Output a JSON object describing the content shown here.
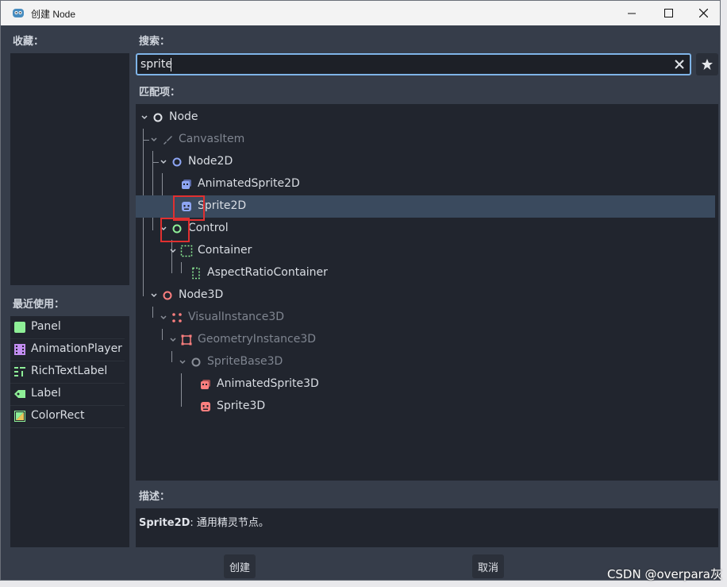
{
  "window": {
    "title": "创建 Node"
  },
  "labels": {
    "favorites": "收藏：",
    "recent": "最近使用：",
    "search": "搜索：",
    "matches": "匹配项：",
    "description": "描述："
  },
  "search": {
    "value": "sprite",
    "placeholder": ""
  },
  "tree": [
    {
      "label": "Node",
      "icon": "node-icon",
      "depth": 0,
      "dim": false,
      "selected": false
    },
    {
      "label": "CanvasItem",
      "icon": "canvasitem-icon",
      "depth": 1,
      "dim": true,
      "selected": false
    },
    {
      "label": "Node2D",
      "icon": "node2d-icon",
      "depth": 2,
      "dim": false,
      "selected": false
    },
    {
      "label": "AnimatedSprite2D",
      "icon": "animatedsprite2d-icon",
      "depth": 3,
      "dim": false,
      "selected": false
    },
    {
      "label": "Sprite2D",
      "icon": "sprite2d-icon",
      "depth": 3,
      "dim": false,
      "selected": true
    },
    {
      "label": "Control",
      "icon": "control-icon",
      "depth": 2,
      "dim": false,
      "selected": false
    },
    {
      "label": "Container",
      "icon": "container-icon",
      "depth": 3,
      "dim": false,
      "selected": false
    },
    {
      "label": "AspectRatioContainer",
      "icon": "aspectratiocontainer-icon",
      "depth": 4,
      "dim": false,
      "selected": false
    },
    {
      "label": "Node3D",
      "icon": "node3d-icon",
      "depth": 1,
      "dim": false,
      "selected": false
    },
    {
      "label": "VisualInstance3D",
      "icon": "visualinstance3d-icon",
      "depth": 2,
      "dim": true,
      "selected": false
    },
    {
      "label": "GeometryInstance3D",
      "icon": "geometryinstance3d-icon",
      "depth": 3,
      "dim": true,
      "selected": false
    },
    {
      "label": "SpriteBase3D",
      "icon": "spritebase3d-icon",
      "depth": 4,
      "dim": true,
      "selected": false
    },
    {
      "label": "AnimatedSprite3D",
      "icon": "animatedsprite3d-icon",
      "depth": 5,
      "dim": false,
      "selected": false
    },
    {
      "label": "Sprite3D",
      "icon": "sprite3d-icon",
      "depth": 5,
      "dim": false,
      "selected": false
    }
  ],
  "recent": [
    {
      "label": "Panel",
      "icon": "panel-icon"
    },
    {
      "label": "AnimationPlayer",
      "icon": "animationplayer-icon"
    },
    {
      "label": "RichTextLabel",
      "icon": "richtextlabel-icon"
    },
    {
      "label": "Label",
      "icon": "label-icon"
    },
    {
      "label": "ColorRect",
      "icon": "colorrect-icon"
    }
  ],
  "description": {
    "name": "Sprite2D",
    "text": ": 通用精灵节点。"
  },
  "buttons": {
    "create": "创建",
    "cancel": "取消"
  },
  "watermark": "CSDN @overpara灰",
  "colors": {
    "accent": "#7fb4e8",
    "selection": "#3a4a5e",
    "node2d": "#8da5f3",
    "control": "#8eef97",
    "node3d": "#fc7f7f",
    "highlight": "#e03030"
  }
}
